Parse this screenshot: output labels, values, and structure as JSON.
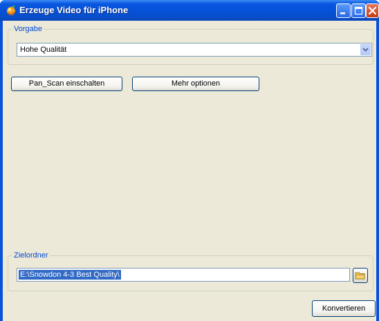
{
  "window": {
    "title": "Erzeuge Video für iPhone"
  },
  "preset": {
    "group_label": "Vorgabe",
    "selected": "Hohe Qualität"
  },
  "buttons": {
    "pan_scan": "Pan_Scan einschalten",
    "more_options": "Mehr optionen",
    "convert": "Konvertieren"
  },
  "output": {
    "group_label": "Zielordner",
    "path": "E:\\Snowdon 4-3 Best Quality\\"
  },
  "colors": {
    "title_bar": "#0551d8",
    "window_bg": "#ece9d8",
    "group_label": "#0046d5",
    "selection": "#316ac5"
  },
  "icons": [
    "app-icon",
    "minimize-icon",
    "maximize-icon",
    "close-icon",
    "chevron-down-icon",
    "folder-icon"
  ]
}
